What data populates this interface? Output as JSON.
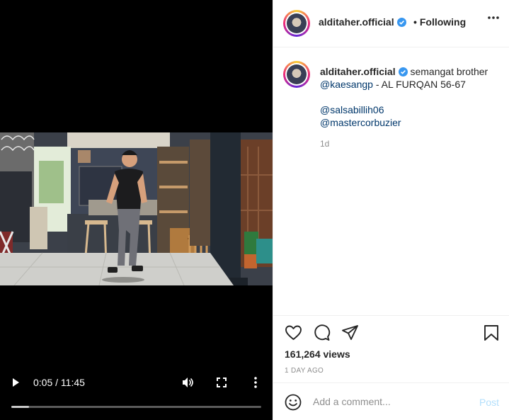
{
  "video": {
    "time_display": "0:05 / 11:45",
    "progress_fraction": 0.07
  },
  "post": {
    "username": "alditaher.official",
    "follow_status": "Following",
    "caption": {
      "username": "alditaher.official",
      "text": "semangat brother",
      "mention_1": "@kaesangp",
      "text_2": "- AL FURQAN 56-67",
      "mention_2": "@salsabillih06",
      "mention_3": "@mastercorbuzier"
    },
    "time_ago": "1d",
    "views": "161,264 views",
    "date": "1 DAY AGO"
  },
  "comment": {
    "placeholder": "Add a comment...",
    "post_label": "Post"
  },
  "icons": {
    "play": "play-icon",
    "volume": "volume-icon",
    "fullscreen": "fullscreen-icon",
    "more": "more-vertical-icon",
    "options": "more-horizontal-icon",
    "like": "heart-icon",
    "comment": "comment-icon",
    "share": "send-icon",
    "save": "bookmark-icon",
    "emoji": "emoji-icon",
    "verified": "verified-badge-icon"
  },
  "colors": {
    "verified": "#3897f0",
    "mention": "#00376b",
    "post_disabled": "#b2dffc"
  }
}
